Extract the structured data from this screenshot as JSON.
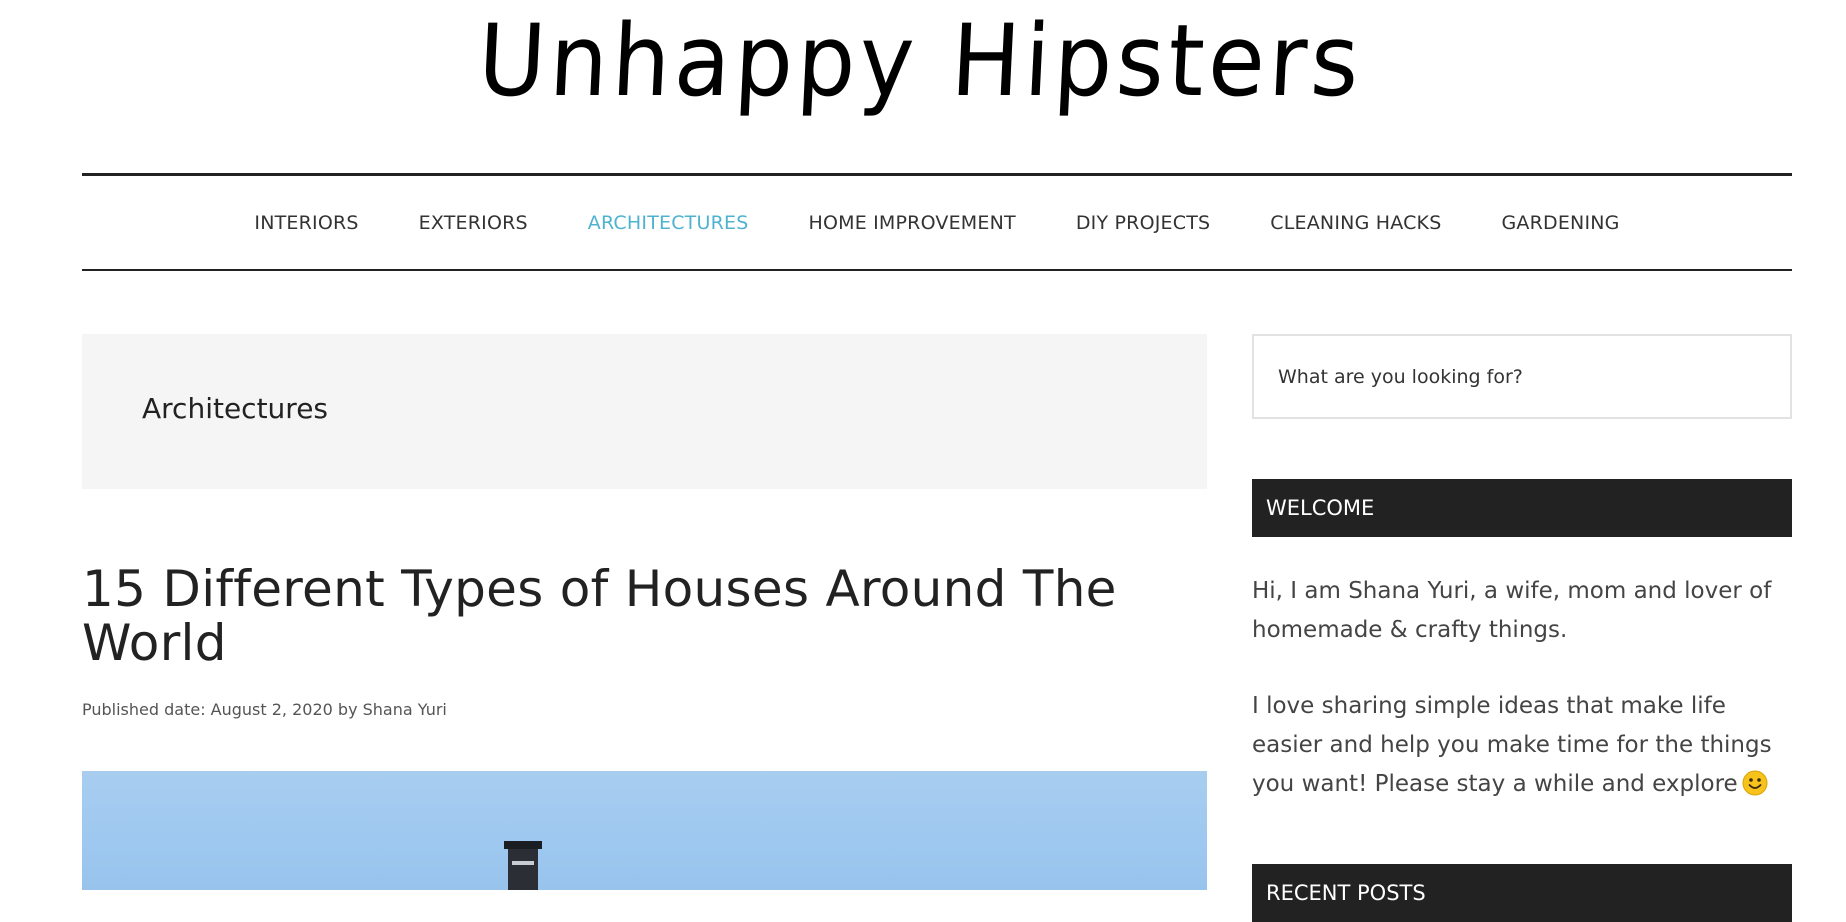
{
  "site": {
    "title": "Unhappy Hipsters"
  },
  "nav": {
    "items": [
      {
        "label": "INTERIORS",
        "active": false
      },
      {
        "label": "EXTERIORS",
        "active": false
      },
      {
        "label": "ARCHITECTURES",
        "active": true
      },
      {
        "label": "HOME IMPROVEMENT",
        "active": false
      },
      {
        "label": "DIY PROJECTS",
        "active": false
      },
      {
        "label": "CLEANING HACKS",
        "active": false
      },
      {
        "label": "GARDENING",
        "active": false
      }
    ],
    "active_color": "#4fb3cf"
  },
  "archive": {
    "title": "Architectures"
  },
  "post": {
    "title": "15 Different Types of Houses Around The World",
    "meta": "Published date: August 2, 2020 by Shana Yuri"
  },
  "sidebar": {
    "search": {
      "placeholder": "What are you looking for?"
    },
    "welcome": {
      "heading": "WELCOME",
      "paragraph1": "Hi, I am Shana Yuri, a wife, mom and lover of homemade & crafty things.",
      "paragraph2": "I love sharing simple ideas that make life easier and help you make time for the things you want! Please stay a while and explore",
      "emoji_icon": "smiley-face-icon"
    },
    "recent_posts": {
      "heading": "RECENT POSTS"
    }
  }
}
